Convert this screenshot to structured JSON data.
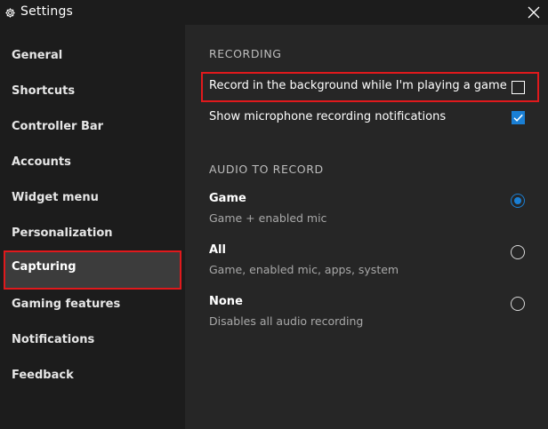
{
  "window": {
    "title": "Settings",
    "icon": "gear-icon",
    "close_icon": "close-icon"
  },
  "colors": {
    "accent": "#1a7fd4",
    "highlight_border": "#e0191c",
    "sidebar_bg": "#1c1c1c",
    "content_bg": "#262626",
    "selected_bg": "#3c3c3c"
  },
  "sidebar": {
    "items": [
      {
        "label": "General",
        "selected": false
      },
      {
        "label": "Shortcuts",
        "selected": false
      },
      {
        "label": "Controller Bar",
        "selected": false
      },
      {
        "label": "Accounts",
        "selected": false
      },
      {
        "label": "Widget menu",
        "selected": false
      },
      {
        "label": "Personalization",
        "selected": false
      },
      {
        "label": "Capturing",
        "selected": true
      },
      {
        "label": "Gaming features",
        "selected": false
      },
      {
        "label": "Notifications",
        "selected": false
      },
      {
        "label": "Feedback",
        "selected": false
      }
    ]
  },
  "recording": {
    "header": "RECORDING",
    "settings": [
      {
        "label": "Record in the background while I'm playing a game",
        "checked": false
      },
      {
        "label": "Show microphone recording notifications",
        "checked": true
      }
    ]
  },
  "audio": {
    "header": "AUDIO TO RECORD",
    "options": [
      {
        "title": "Game",
        "description": "Game + enabled mic",
        "selected": true
      },
      {
        "title": "All",
        "description": "Game, enabled mic, apps, system",
        "selected": false
      },
      {
        "title": "None",
        "description": "Disables all audio recording",
        "selected": false
      }
    ]
  }
}
